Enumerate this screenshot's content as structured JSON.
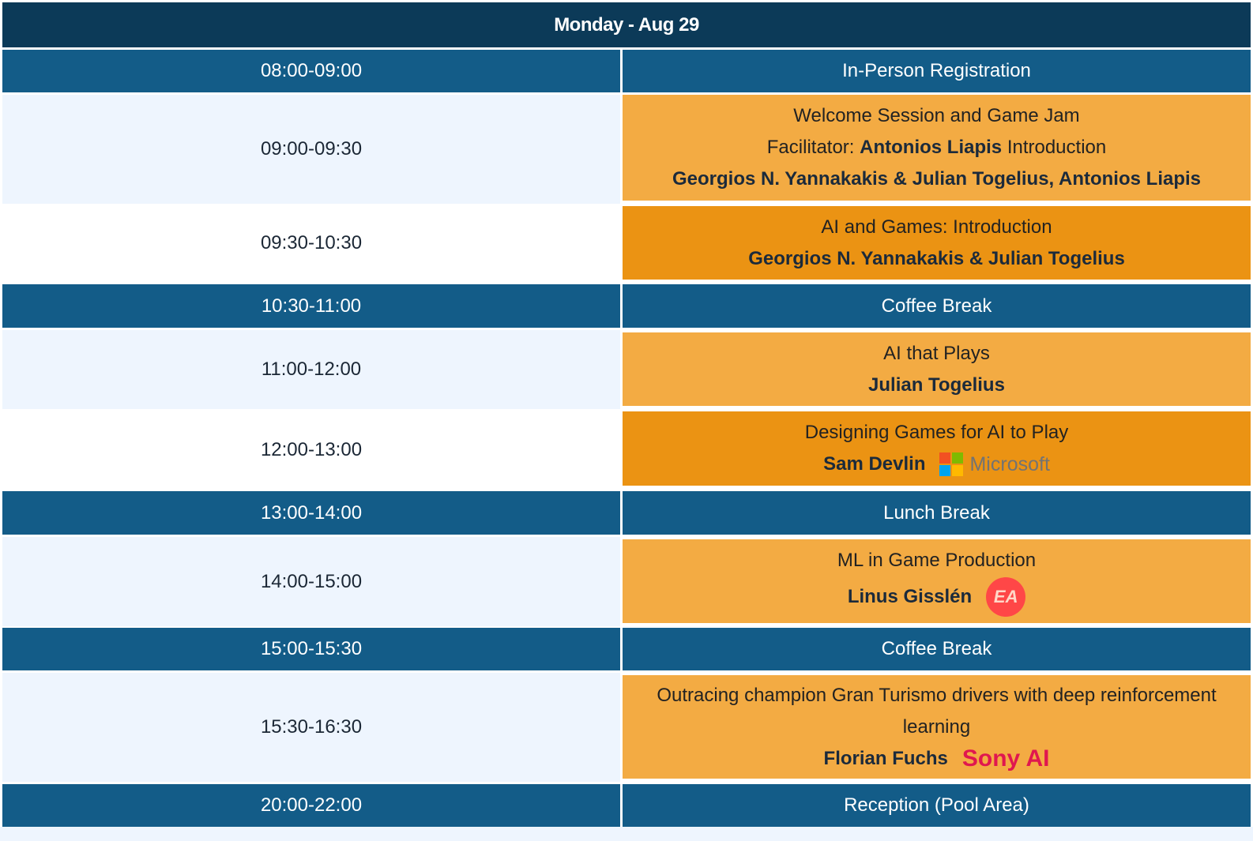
{
  "day_header": "Monday - Aug 29",
  "colors": {
    "header_bg": "#0c3a58",
    "break_bg": "#135c88",
    "session_bg_light": "#f3ab43",
    "session_bg_dark": "#eb9313"
  },
  "rows": [
    {
      "time": "08:00-09:00",
      "title": "In-Person Registration"
    },
    {
      "time": "09:00-09:30",
      "title": "Welcome Session and Game Jam",
      "facilitator_prefix": "Facilitator:",
      "facilitator_name": "Antonios Liapis",
      "facilitator_suffix": "Introduction",
      "speakers": "Georgios N. Yannakakis & Julian Togelius, Antonios Liapis"
    },
    {
      "time": "09:30-10:30",
      "title": "AI and Games: Introduction",
      "speakers": "Georgios N. Yannakakis & Julian Togelius"
    },
    {
      "time": "10:30-11:00",
      "title": "Coffee Break"
    },
    {
      "time": "11:00-12:00",
      "title": "AI that Plays",
      "speakers": "Julian Togelius"
    },
    {
      "time": "12:00-13:00",
      "title": "Designing Games for AI to Play",
      "speakers": "Sam Devlin",
      "logo": "Microsoft",
      "logo_icon": "microsoft-logo-icon"
    },
    {
      "time": "13:00-14:00",
      "title": "Lunch Break"
    },
    {
      "time": "14:00-15:00",
      "title": "ML in Game Production",
      "speakers": "Linus Gisslén",
      "logo": "EA",
      "logo_icon": "ea-logo-icon"
    },
    {
      "time": "15:00-15:30",
      "title": "Coffee Break"
    },
    {
      "time": "15:30-16:30",
      "title": "Outracing champion Gran Turismo drivers with deep reinforcement learning",
      "speakers": "Florian Fuchs",
      "logo": "Sony AI"
    },
    {
      "time": "20:00-22:00",
      "title": "Reception (Pool Area)"
    }
  ]
}
